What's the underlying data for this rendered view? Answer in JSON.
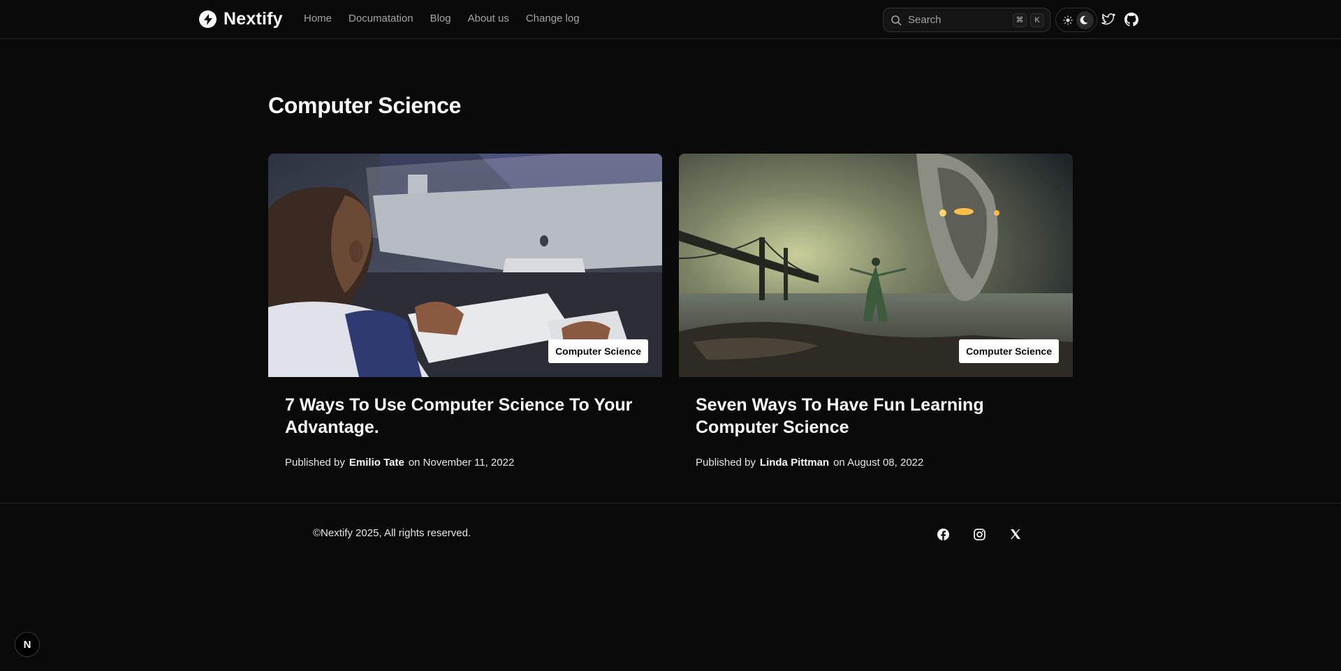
{
  "header": {
    "brand": "Nextify",
    "nav": [
      "Home",
      "Documatation",
      "Blog",
      "About us",
      "Change log"
    ],
    "search": {
      "label": "Search",
      "keys": [
        "⌘",
        "K"
      ]
    }
  },
  "main": {
    "title": "Computer Science",
    "posts": [
      {
        "tag": "Computer Science",
        "title": "7 Ways To Use Computer Science To Your Advantage.",
        "published_by": "Published by",
        "author": "Emilio Tate",
        "date": "on November 11, 2022"
      },
      {
        "tag": "Computer Science",
        "title": "Seven Ways To Have Fun Learning Computer Science",
        "published_by": "Published by",
        "author": "Linda Pittman",
        "date": "on August 08, 2022"
      }
    ]
  },
  "footer": {
    "copyright": "©Nextify 2025, All rights reserved."
  },
  "floating_badge": "N",
  "colors": {
    "background": "#0a0a0a",
    "text": "#fafafa",
    "muted": "#a3a3a3",
    "border": "#262626"
  }
}
